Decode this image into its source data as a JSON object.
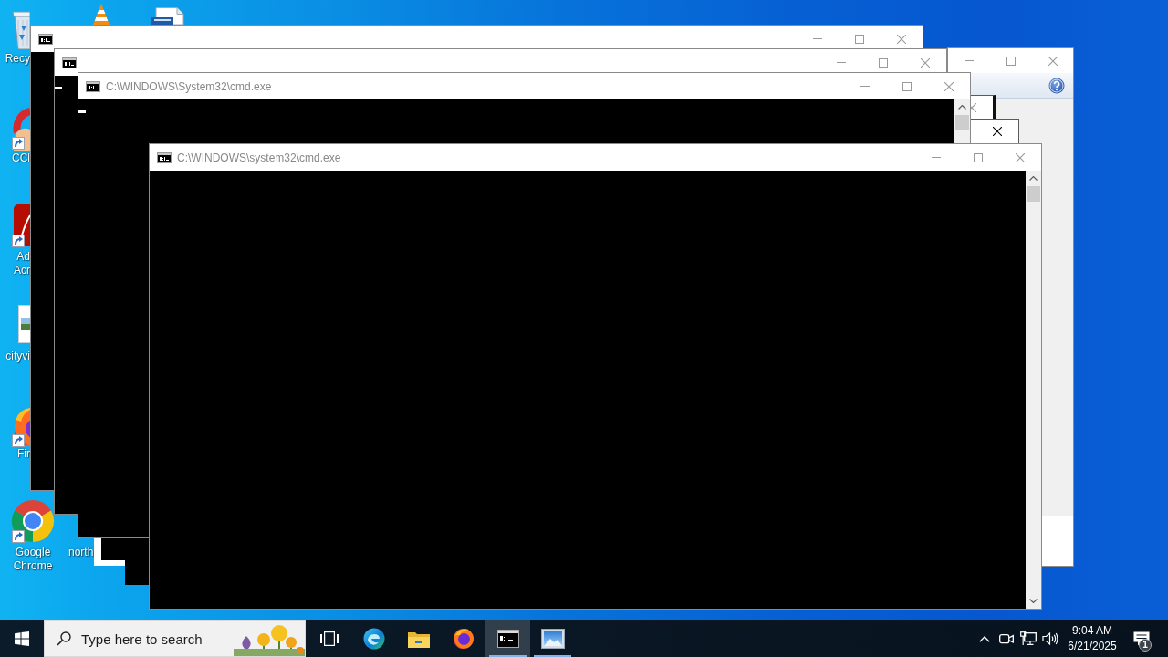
{
  "desktop": {
    "icons": [
      {
        "kind": "recycle-bin",
        "label": "Recy",
        "shortcut": false
      },
      {
        "kind": "cone"
      },
      {
        "kind": "document"
      },
      {
        "kind": "cleaner",
        "label": "CCl",
        "shortcut": true
      },
      {
        "kind": "acrobat",
        "label": "Ad Acr",
        "shortcut": true
      },
      {
        "kind": "image-file",
        "label": "cityvi",
        "shortcut": false
      },
      {
        "kind": "firefox",
        "label": "Fir",
        "shortcut": true
      },
      {
        "kind": "chrome",
        "label": "Google Chrome",
        "shortcut": true
      },
      {
        "label": "north"
      }
    ]
  },
  "windows": [
    {
      "kind": "dialog",
      "active": false
    },
    {
      "kind": "console",
      "active": false,
      "cursor": false
    },
    {
      "kind": "console",
      "active": false,
      "cursor": true
    },
    {
      "kind": "message",
      "active": false
    },
    {
      "kind": "message",
      "active": true
    },
    {
      "kind": "frame"
    },
    {
      "kind": "blank"
    },
    {
      "kind": "console",
      "title": "C:\\WINDOWS\\System32\\cmd.exe",
      "active": false,
      "cursor": true
    },
    {
      "kind": "console",
      "title": "C:\\WINDOWS\\system32\\cmd.exe",
      "active": false,
      "cursor": false
    }
  ],
  "taskbar": {
    "search": {
      "placeholder": "Type here to search"
    },
    "apps": [
      {
        "kind": "task-view",
        "running": false,
        "selected": false
      },
      {
        "kind": "edge",
        "running": false,
        "selected": false
      },
      {
        "kind": "explorer",
        "running": false,
        "selected": false
      },
      {
        "kind": "firefox",
        "running": false,
        "selected": false
      },
      {
        "kind": "console",
        "running": true,
        "selected": true
      },
      {
        "kind": "photos",
        "running": true,
        "selected": false
      }
    ],
    "clock": {
      "time": "9:04 AM",
      "date": "6/21/2025"
    },
    "notifications": {
      "count": "1"
    }
  }
}
